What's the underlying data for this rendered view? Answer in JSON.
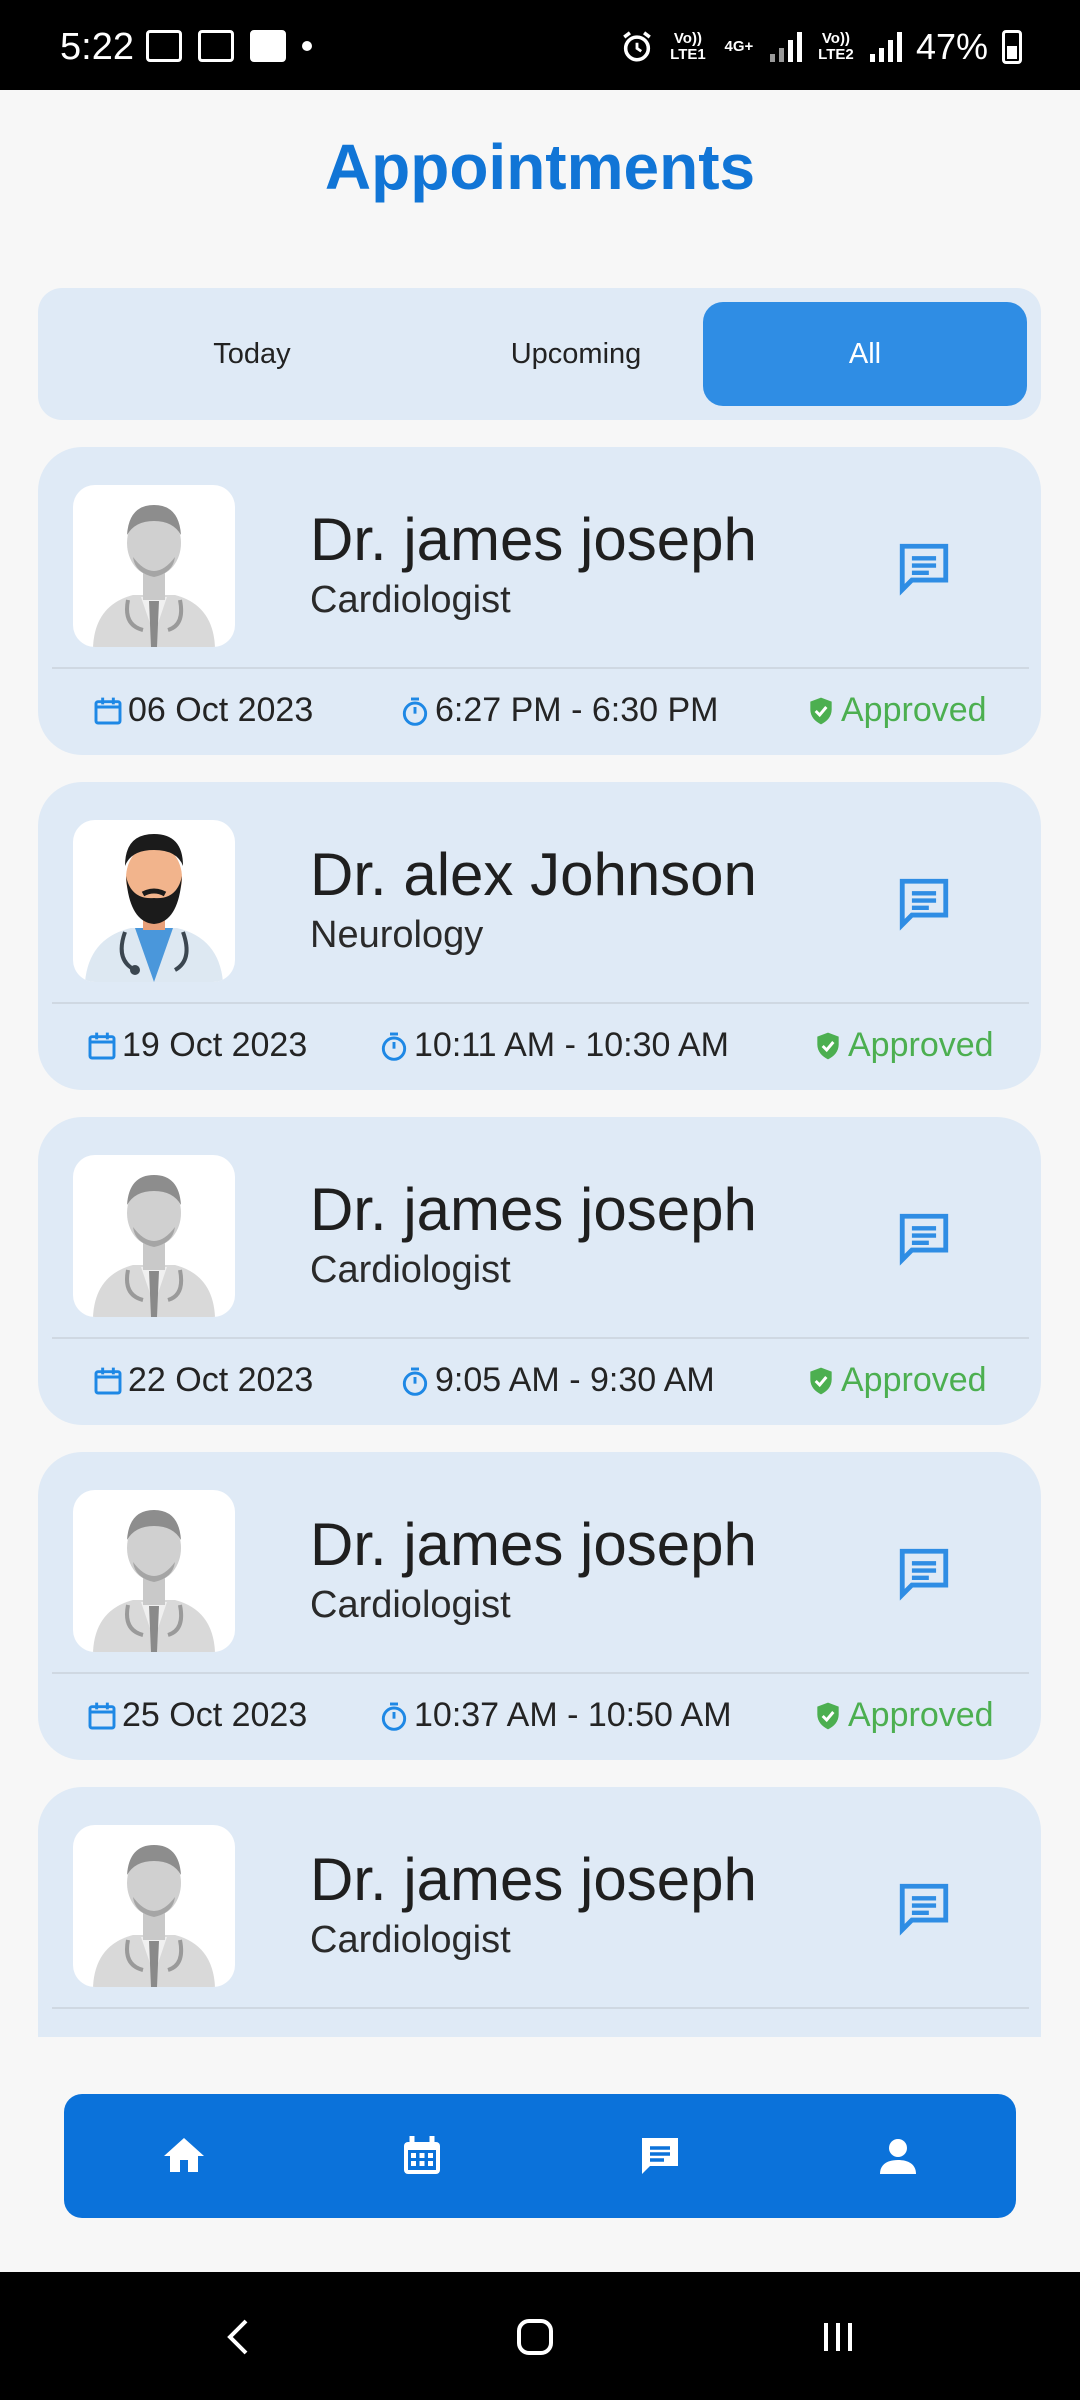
{
  "status_bar": {
    "time": "5:22",
    "battery": "47%",
    "sim1": "Vo)) LTE1",
    "net": "4G+",
    "sim2": "Vo)) LTE2"
  },
  "header": {
    "title": "Appointments"
  },
  "tabs": [
    {
      "label": "Today",
      "selected": false
    },
    {
      "label": "Upcoming",
      "selected": false
    },
    {
      "label": "All",
      "selected": true
    }
  ],
  "colors": {
    "accent": "#1175d6",
    "card_bg": "#dfeaf6",
    "approved": "#4caf50",
    "icon_blue": "#2f8de4"
  },
  "appointments": [
    {
      "name": "Dr. james joseph",
      "specialty": "Cardiologist",
      "date": "06 Oct 2023",
      "time": "6:27 PM - 6:30 PM",
      "status": "Approved",
      "avatar": "doctor-gray-avatar"
    },
    {
      "name": "Dr. alex Johnson",
      "specialty": "Neurology",
      "date": "19 Oct 2023",
      "time": "10:11 AM - 10:30 AM",
      "status": "Approved",
      "avatar": "doctor-bearded-avatar"
    },
    {
      "name": "Dr. james joseph",
      "specialty": "Cardiologist",
      "date": "22 Oct 2023",
      "time": "9:05 AM - 9:30 AM",
      "status": "Approved",
      "avatar": "doctor-gray-avatar"
    },
    {
      "name": "Dr. james joseph",
      "specialty": "Cardiologist",
      "date": "25 Oct 2023",
      "time": "10:37 AM - 10:50 AM",
      "status": "Approved",
      "avatar": "doctor-gray-avatar"
    },
    {
      "name": "Dr. james joseph",
      "specialty": "Cardiologist",
      "date": "",
      "time": "",
      "status": "",
      "avatar": "doctor-gray-avatar"
    }
  ],
  "bottom_nav": [
    {
      "icon": "home-icon"
    },
    {
      "icon": "calendar-icon"
    },
    {
      "icon": "chat-icon"
    },
    {
      "icon": "profile-icon"
    }
  ]
}
